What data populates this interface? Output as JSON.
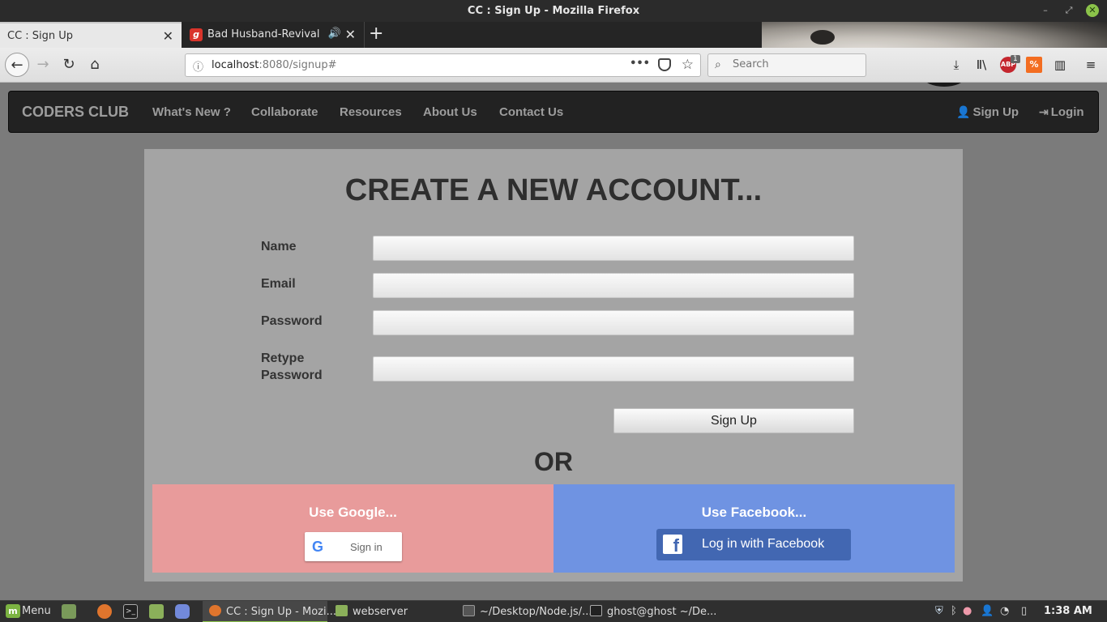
{
  "window": {
    "title": "CC : Sign Up - Mozilla Firefox"
  },
  "tabs": [
    {
      "label": "CC : Sign Up",
      "active": true
    },
    {
      "label": "Bad Husband-Revival",
      "active": false,
      "favicon_letter": "g"
    }
  ],
  "navbar": {
    "url_host": "localhost",
    "url_path": ":8080/signup#",
    "search_placeholder": "Search",
    "adblock_count": "1",
    "adblock_label": "ABP"
  },
  "site": {
    "brand": "CODERS CLUB",
    "links": [
      "What's New ?",
      "Collaborate",
      "Resources",
      "About Us",
      "Contact Us"
    ],
    "signup_label": "Sign Up",
    "login_label": "Login"
  },
  "form": {
    "heading": "CREATE A NEW ACCOUNT...",
    "name_label": "Name",
    "email_label": "Email",
    "password_label": "Password",
    "retype_label_line1": "Retype",
    "retype_label_line2": "Password",
    "submit_label": "Sign Up",
    "or_text": "OR"
  },
  "social": {
    "google_title": "Use Google...",
    "google_button": "Sign in",
    "facebook_title": "Use Facebook...",
    "facebook_button": "Log in with Facebook"
  },
  "taskbar": {
    "menu_label": "Menu",
    "tasks": [
      "CC : Sign Up - Mozi...",
      "webserver",
      "~/Desktop/Node.js/...",
      "ghost@ghost ~/De..."
    ],
    "clock": "1:38 AM"
  },
  "colors": {
    "google_panel": "#e89b9b",
    "facebook_panel": "#6f93e2",
    "facebook_button": "#4267b2",
    "site_nav": "#222222",
    "form_panel": "#a4a4a4"
  }
}
